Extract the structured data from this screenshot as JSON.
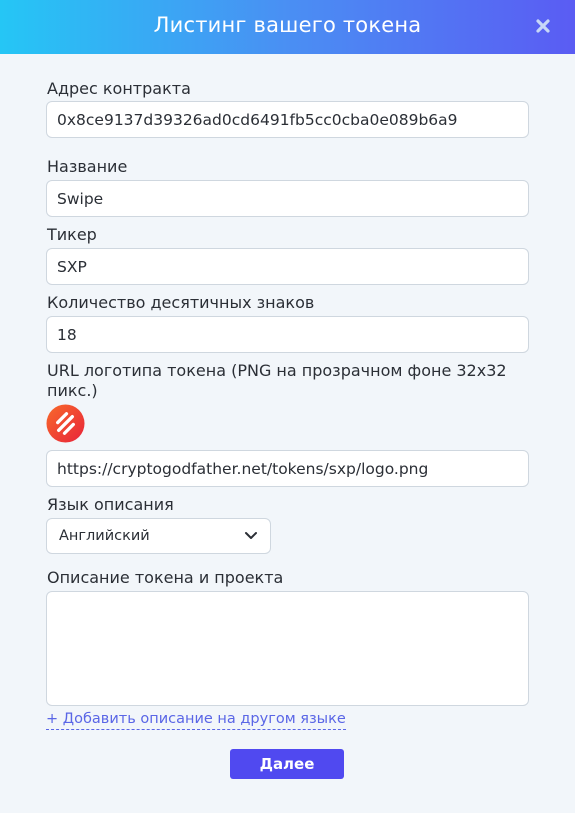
{
  "header": {
    "title": "Листинг вашего токена"
  },
  "fields": {
    "contract_address": {
      "label": "Адрес контракта",
      "value": "0x8ce9137d39326ad0cd6491fb5cc0cba0e089b6a9"
    },
    "name": {
      "label": "Название",
      "value": "Swipe"
    },
    "ticker": {
      "label": "Тикер",
      "value": "SXP"
    },
    "decimals": {
      "label": "Количество десятичных знаков",
      "value": "18"
    },
    "logo_url": {
      "label": "URL логотипа токена (PNG на прозрачном фоне 32x32 пикс.)",
      "value": "https://cryptogodfather.net/tokens/sxp/logo.png"
    },
    "description_language": {
      "label": "Язык описания",
      "value": "Английский"
    },
    "description": {
      "label": "Описание токена и проекта",
      "value": ""
    }
  },
  "add_description_link": "+ Добавить описание на другом языке",
  "next_button": "Далее",
  "icons": {
    "close": "close-icon",
    "logo": "swipe-logo-icon",
    "chevron": "chevron-down-icon"
  },
  "colors": {
    "header_start": "#25c6f5",
    "header_end": "#5a5cf3",
    "button": "#5049f0",
    "link": "#5a66e6",
    "logo_start": "#f86a2a",
    "logo_end": "#e8233a"
  }
}
